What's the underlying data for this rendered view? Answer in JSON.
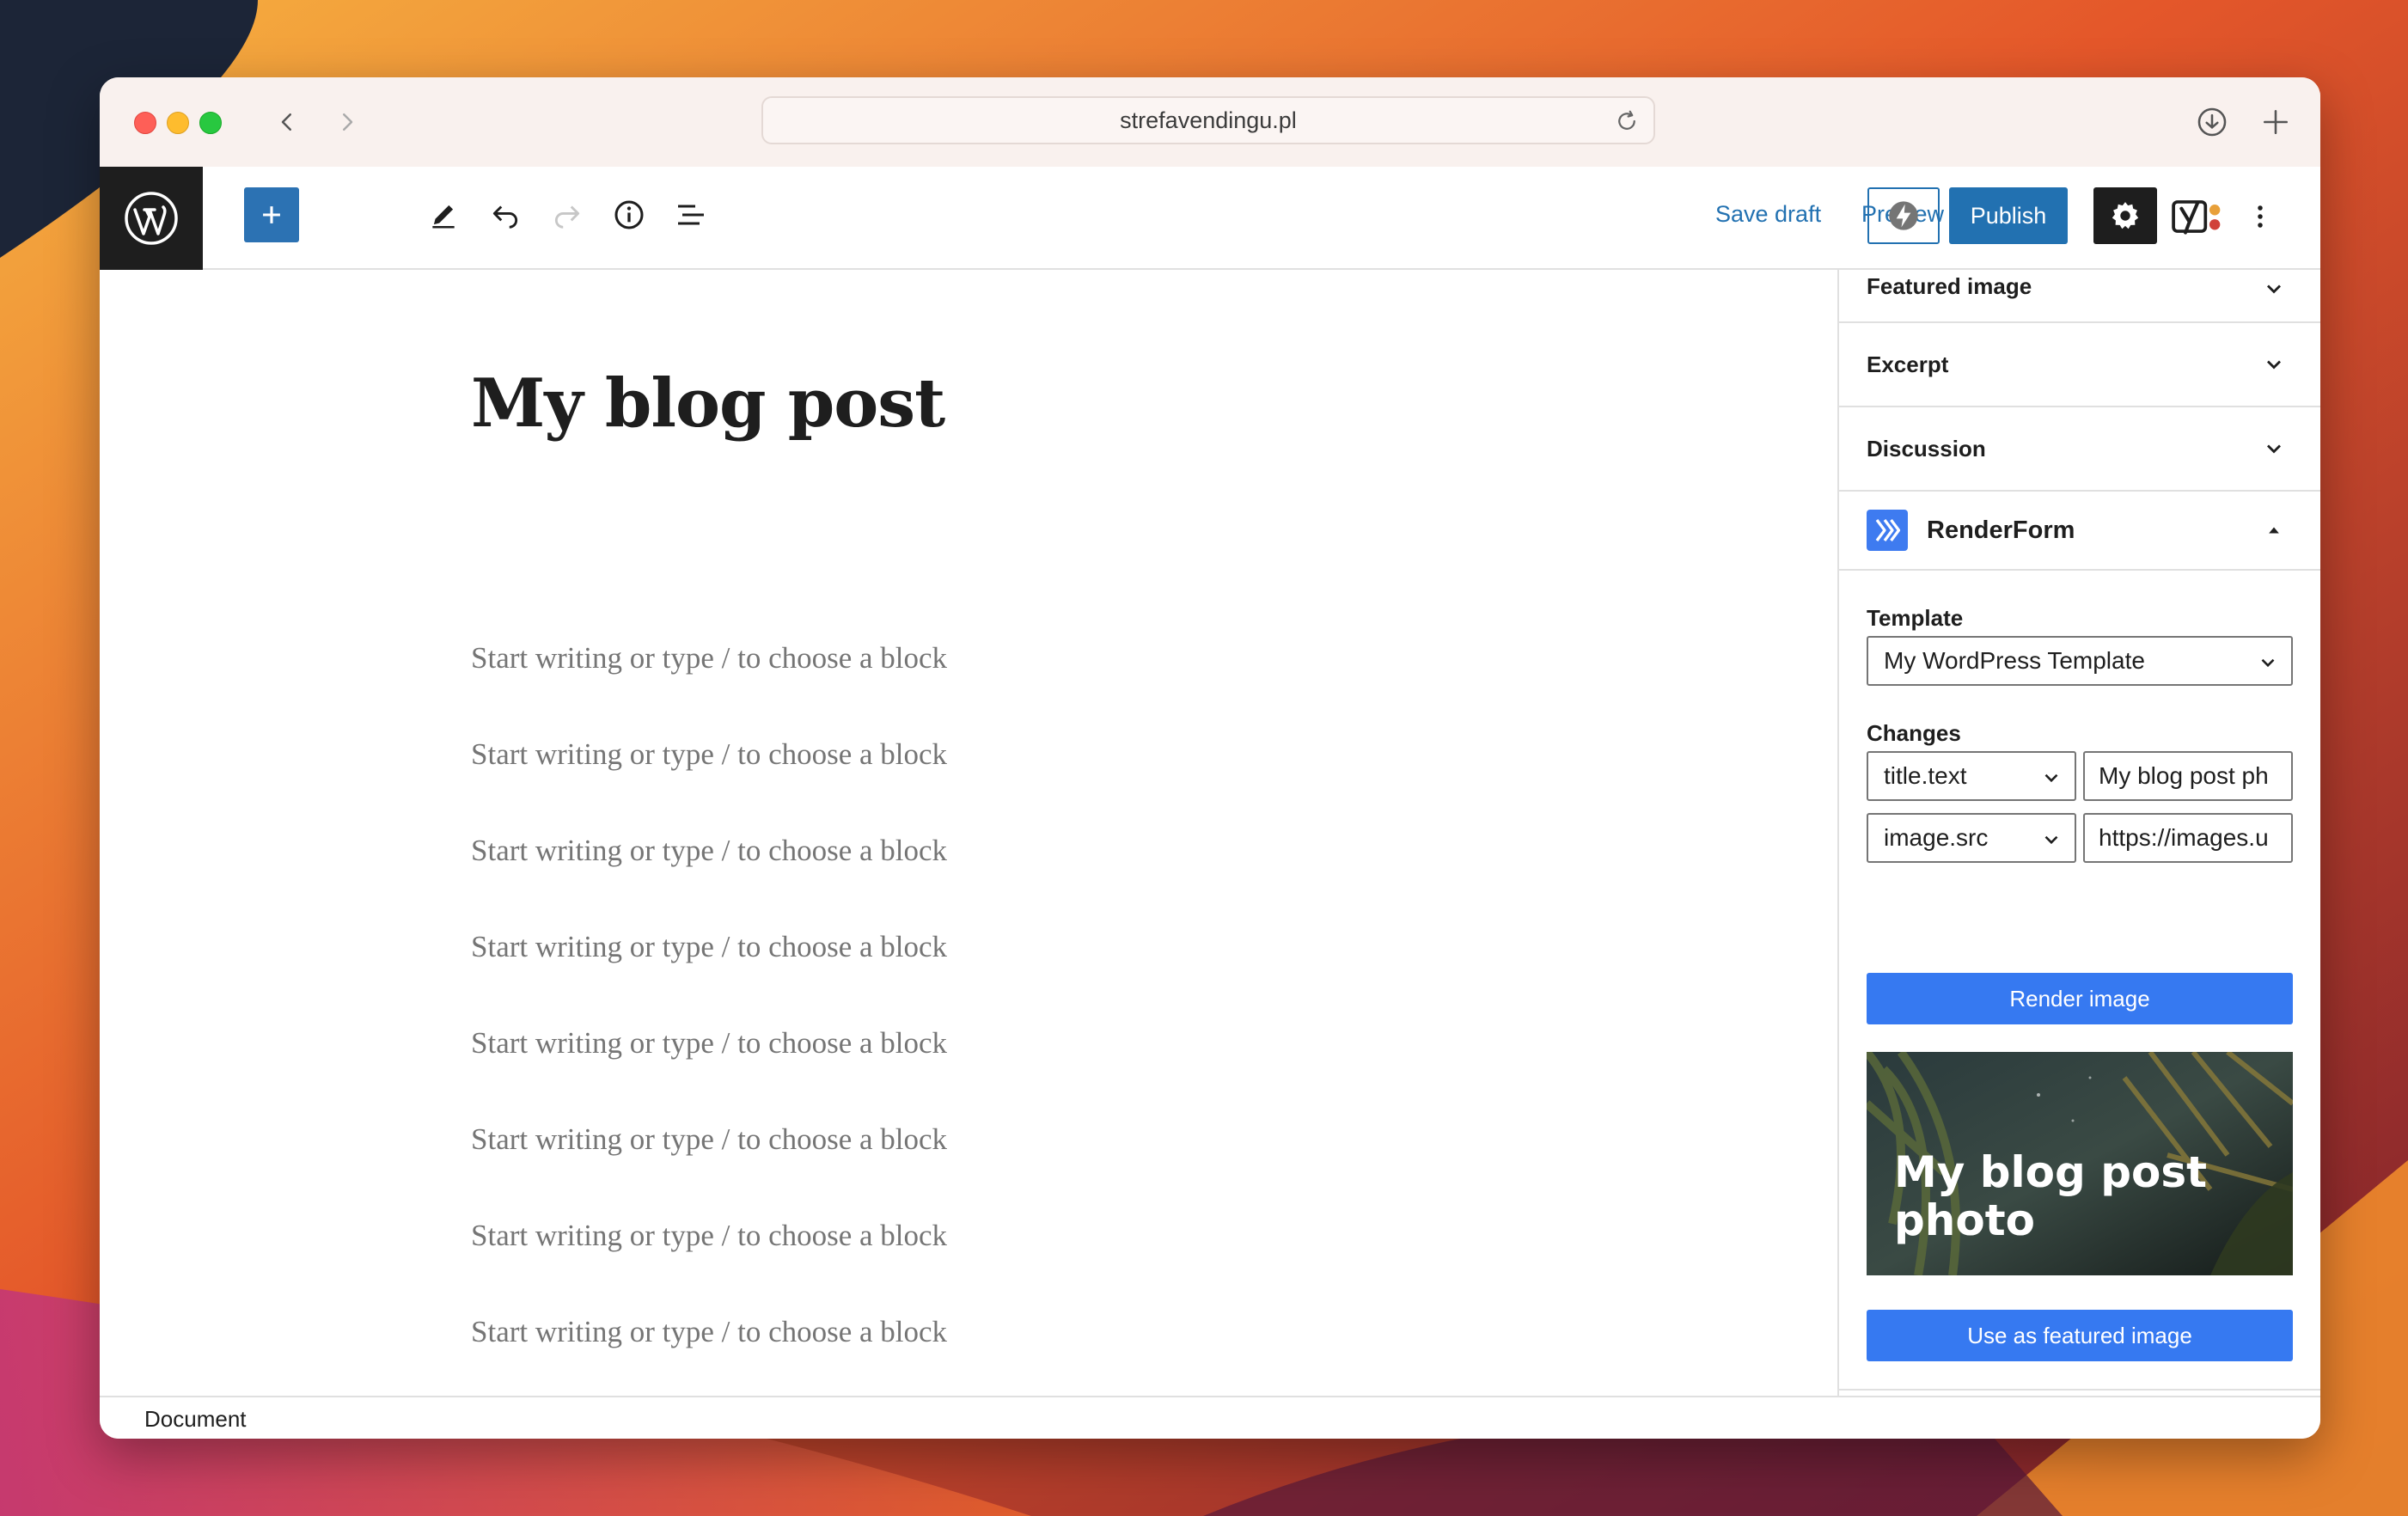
{
  "browser": {
    "url": "strefavendingu.pl"
  },
  "toolbar": {
    "save_draft_label": "Save draft",
    "preview_label": "Preview",
    "publish_label": "Publish"
  },
  "editor": {
    "post_title": "My blog post",
    "block_placeholder": "Start writing or type / to choose a block"
  },
  "sidebar": {
    "panels": {
      "featured_image": "Featured image",
      "excerpt": "Excerpt",
      "discussion": "Discussion"
    },
    "renderform": {
      "title": "RenderForm",
      "template_label": "Template",
      "template_value": "My WordPress Template",
      "changes_label": "Changes",
      "changes": [
        {
          "field": "title.text",
          "value": "My blog post ph"
        },
        {
          "field": "image.src",
          "value": "https://images.u"
        }
      ],
      "render_button": "Render image",
      "preview_text": "My blog post photo",
      "featured_button": "Use as featured image"
    }
  },
  "status_bar": {
    "breadcrumb": "Document"
  },
  "colors": {
    "wp_blue": "#2271b1",
    "renderform_blue": "#3679f1",
    "dark": "#1e1e1e"
  }
}
